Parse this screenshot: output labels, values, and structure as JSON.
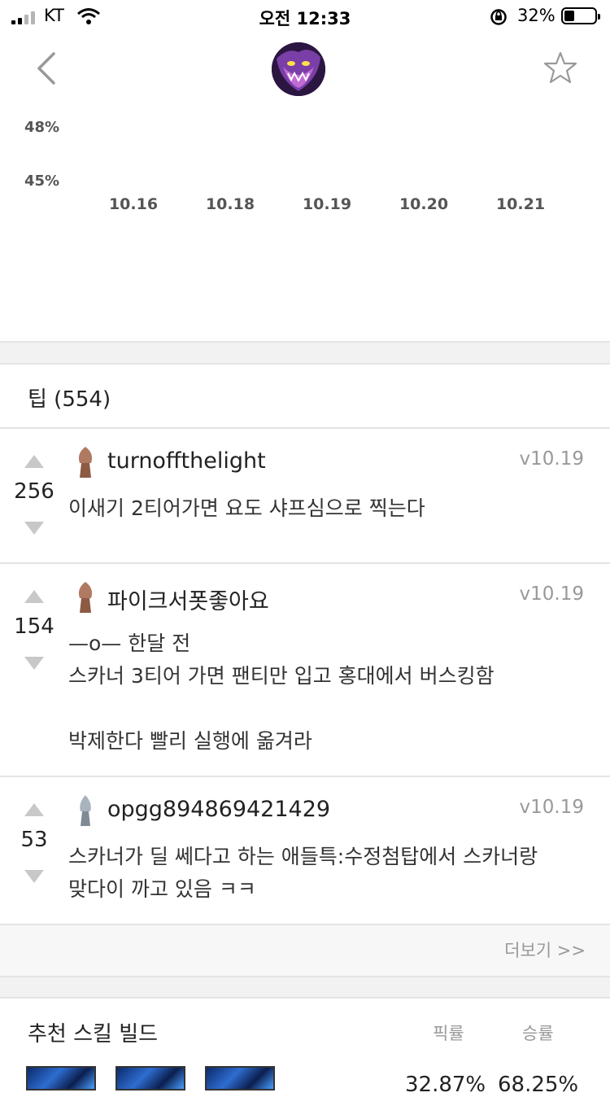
{
  "status_bar": {
    "carrier": "KT",
    "time": "오전 12:33",
    "battery_pct": "32%",
    "battery_level": 0.32
  },
  "chart_data": {
    "type": "line",
    "yticks": [
      "48%",
      "45%"
    ],
    "categories": [
      "10.16",
      "10.18",
      "10.19",
      "10.20",
      "10.21"
    ]
  },
  "tips": {
    "title": "팁 (554)",
    "items": [
      {
        "score": "256",
        "author": "turnoffthelight",
        "version": "v10.19",
        "text": "이새기 2티어가면 요도 샤프심으로 찍는다"
      },
      {
        "score": "154",
        "author": "파이크서폿좋아요",
        "version": "v10.19",
        "text": "—o— 한달 전\n스카너 3티어 가면 팬티만 입고 홍대에서 버스킹함\n\n박제한다 빨리 실행에 옮겨라"
      },
      {
        "score": "53",
        "author": "opgg894869421429",
        "version": "v10.19",
        "text": "스카너가 딜 쎄다고 하는 애들특:수정첨탑에서 스카너랑\n맞다이 까고 있음 ㅋㅋ"
      }
    ],
    "more_label": "더보기 >>"
  },
  "skill_build": {
    "title": "추천 스킬 빌드",
    "pick_label": "픽률",
    "win_label": "승률",
    "pick_rate": "32.87%",
    "win_rate": "68.25%"
  }
}
